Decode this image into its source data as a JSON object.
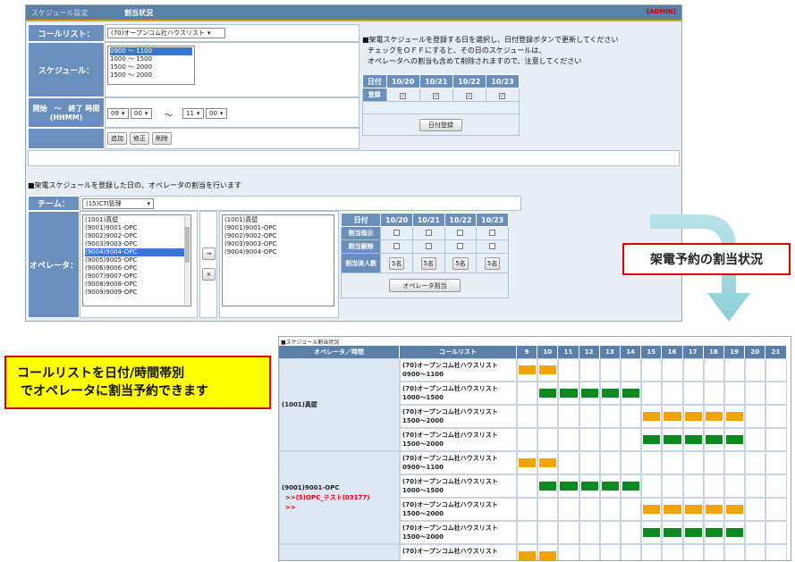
{
  "header": {
    "tab": "スケジュール設定",
    "title": "割当状況",
    "admin": "[ADMIN]"
  },
  "form": {
    "calllist_label": "コールリスト：",
    "calllist_value": "(70)オープンコム社ハウスリスト",
    "schedule_label": "スケジュール：",
    "schedules": [
      "0900 ～ 1100",
      "1000 ～ 1500",
      "1500 ～ 2000",
      "1500 ～ 2000"
    ],
    "time_label_1": "開始　～　終了 時間",
    "time_label_2": "(HHMM)",
    "start_h": "09",
    "start_m": "00",
    "tilde": "～",
    "end_h": "11",
    "end_m": "00",
    "add_btn": "追加",
    "edit_btn": "修正",
    "delete_btn": "削除"
  },
  "note1": [
    "■架電スケジュールを登録する日を選択し、日付登録ボタンで更新してください",
    "チェックをＯＦＦにすると、その日のスケジュールは、",
    "オペレータへの割当も含めて削除されますので、注意してください"
  ],
  "date_table": {
    "head": "日付",
    "dates": [
      "10/20",
      "10/21",
      "10/22",
      "10/23"
    ],
    "row_label": "登録",
    "check": "✓",
    "button": "日付登録"
  },
  "note2": "■架電スケジュールを登録した日の、オペレータの割当を行います",
  "team": {
    "label": "チーム：",
    "value": "(15)CTI管理"
  },
  "operator": {
    "label": "オペレータ：",
    "left_list": [
      "(1001)真壁",
      "(9001)9001-OPC",
      "(9002)9002-OPC",
      "(9003)9003-OPC",
      "(9004)9004-OPC",
      "(9005)9005-OPC",
      "(9006)9006-OPC",
      "(9007)9007-OPC",
      "(9008)9008-OPC",
      "(9009)9009-OPC"
    ],
    "right_list": [
      "(1001)真壁",
      "(9001)9001-OPC",
      "(9002)9002-OPC",
      "(9003)9003-OPC",
      "(9004)9004-OPC"
    ],
    "add_arrow": "→",
    "remove": "×"
  },
  "assign_table": {
    "head": "日付",
    "dates": [
      "10/20",
      "10/21",
      "10/22",
      "10/23"
    ],
    "rows": [
      "割当指示",
      "割当解除",
      "割当済人数"
    ],
    "count": "5名",
    "button": "オペレータ割当"
  },
  "callout1": "架電予約の割当状況",
  "callout2": [
    "コールリストを日付/時間帯別",
    "でオペレータに割当予約できます"
  ],
  "sched_panel": {
    "caption": "■スケジュール割当状況",
    "col_op": "オペレータ／時間",
    "col_list": "コールリスト",
    "hours": [
      "9",
      "10",
      "11",
      "12",
      "13",
      "14",
      "15",
      "16",
      "17",
      "18",
      "19",
      "20",
      "21"
    ],
    "colors": {
      "orange": "#f5a300",
      "green": "#0a8a1f"
    },
    "groups": [
      {
        "operator": "(1001)真壁",
        "sub": [],
        "rows": [
          {
            "list": "(70)オープンコム社ハウスリスト",
            "time": "0900～1100",
            "start": 9,
            "end": 11,
            "color": "orange"
          },
          {
            "list": "(70)オープンコム社ハウスリスト",
            "time": "1000～1500",
            "start": 10,
            "end": 15,
            "color": "green"
          },
          {
            "list": "(70)オープンコム社ハウスリスト",
            "time": "1500～2000",
            "start": 15,
            "end": 20,
            "color": "orange"
          },
          {
            "list": "(70)オープンコム社ハウスリスト",
            "time": "1500～2000",
            "start": 15,
            "end": 20,
            "color": "green"
          }
        ]
      },
      {
        "operator": "(9001)9001-OPC",
        "sub": [
          ">>(5)OPC_テスト(03177)",
          ">>"
        ],
        "rows": [
          {
            "list": "(70)オープンコム社ハウスリスト",
            "time": "0900～1100",
            "start": 9,
            "end": 11,
            "color": "orange"
          },
          {
            "list": "(70)オープンコム社ハウスリスト",
            "time": "1000～1500",
            "start": 10,
            "end": 15,
            "color": "green"
          },
          {
            "list": "(70)オープンコム社ハウスリスト",
            "time": "1500～2000",
            "start": 15,
            "end": 20,
            "color": "orange"
          },
          {
            "list": "(70)オープンコム社ハウスリスト",
            "time": "1500～2000",
            "start": 15,
            "end": 20,
            "color": "green"
          }
        ]
      },
      {
        "operator": "",
        "sub": [],
        "rows": [
          {
            "list": "(70)オープンコム社ハウスリスト",
            "time": "",
            "start": 9,
            "end": 11,
            "color": "orange"
          }
        ]
      }
    ]
  }
}
